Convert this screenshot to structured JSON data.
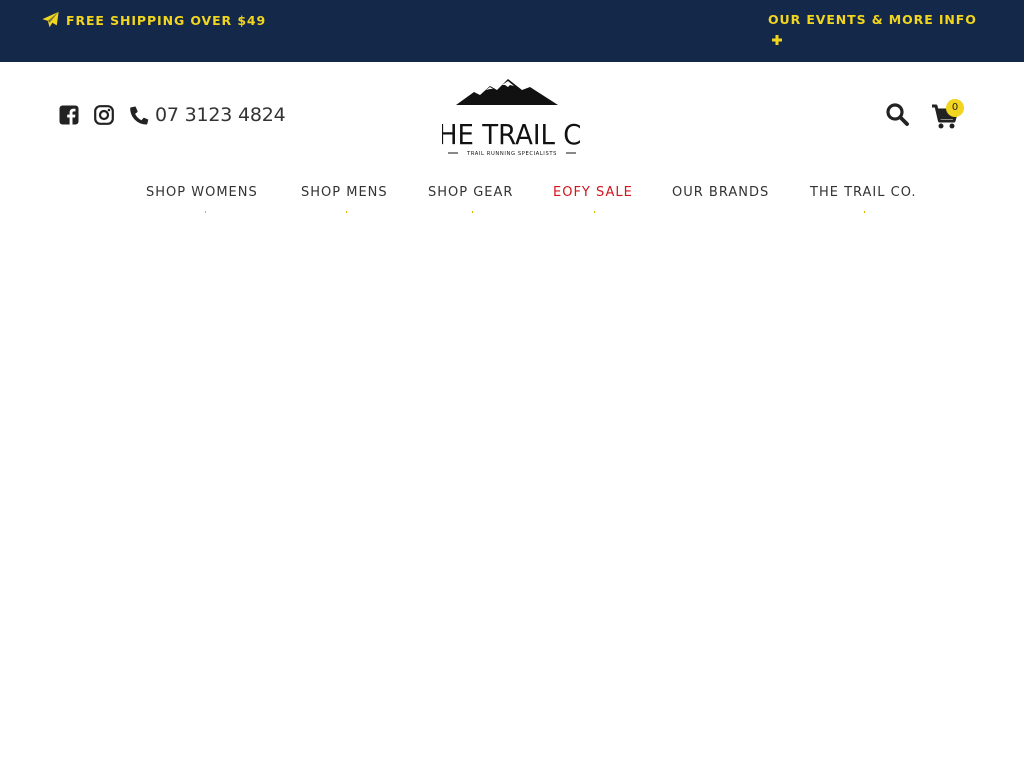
{
  "topbar": {
    "shipping_text": "FREE SHIPPING OVER $49",
    "events_text": "OUR EVENTS & MORE INFO",
    "accent_color": "#f2d51e",
    "background_color": "#14294a",
    "shipping_icon": "paper-plane-icon",
    "events_icon": "plus-icon"
  },
  "header": {
    "social_icons": [
      "facebook-icon",
      "instagram-icon"
    ],
    "phone": "07 3123 4824",
    "logo": {
      "title": "THE TRAIL CO",
      "tagline": "TRAIL RUNNING SPECIALISTS"
    },
    "cart_count": "0",
    "icons": [
      "search-icon",
      "cart-icon"
    ]
  },
  "nav": {
    "items": [
      {
        "label": "SHOP WOMENS"
      },
      {
        "label": "SHOP MENS"
      },
      {
        "label": "SHOP GEAR"
      },
      {
        "label": "EOFY SALE"
      },
      {
        "label": "OUR BRANDS"
      },
      {
        "label": "THE TRAIL CO."
      }
    ],
    "sale_color": "#d3151c"
  }
}
